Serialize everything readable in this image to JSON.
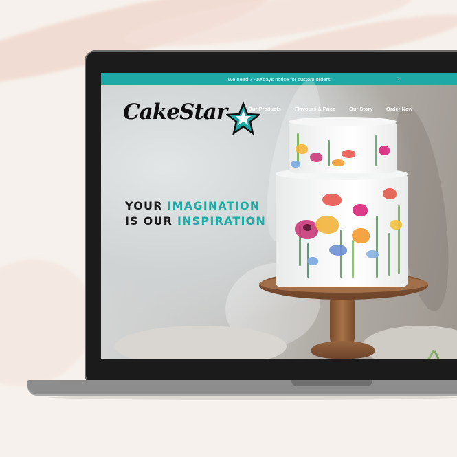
{
  "announcement": {
    "text": "We need 7 -10 days notice for custom orders",
    "prev_icon": "chevron-left-icon",
    "next_icon": "chevron-right-icon"
  },
  "logo": {
    "text": "CakeStar",
    "star_icon": "star-icon"
  },
  "nav": {
    "items": [
      {
        "label": "Our Products"
      },
      {
        "label": "Flavours & Price"
      },
      {
        "label": "Our Story"
      },
      {
        "label": "Order Now"
      }
    ]
  },
  "hero": {
    "line1_plain": "YOUR ",
    "line1_accent": "IMAGINATION",
    "line2_plain": "IS OUR ",
    "line2_accent": "INSPIRATION"
  },
  "colors": {
    "accent": "#1ea8a6",
    "text_dark": "#1a1a1a",
    "background": "#f6f1ec"
  }
}
